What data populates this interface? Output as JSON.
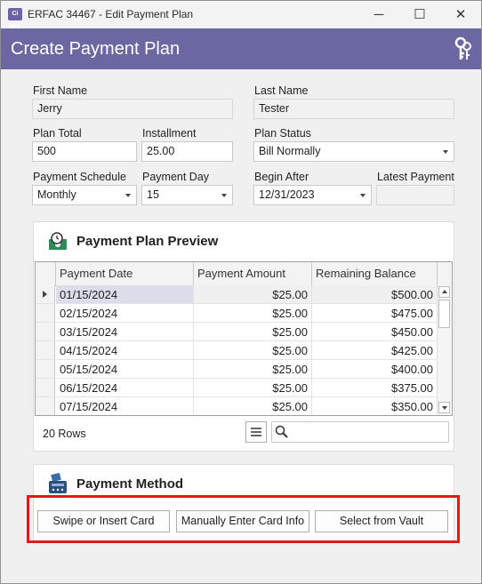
{
  "window": {
    "title": "ERFAC 34467 - Edit Payment Plan",
    "app_icon_text": "Ci pay",
    "minimize": "─",
    "maximize": "☐",
    "close": "✕"
  },
  "header": {
    "title": "Create Payment Plan"
  },
  "form": {
    "first_name_label": "First Name",
    "first_name_value": "Jerry",
    "last_name_label": "Last Name",
    "last_name_value": "Tester",
    "plan_total_label": "Plan Total",
    "plan_total_value": "500",
    "installment_label": "Installment",
    "installment_value": "25.00",
    "plan_status_label": "Plan Status",
    "plan_status_value": "Bill Normally",
    "payment_schedule_label": "Payment Schedule",
    "payment_schedule_value": "Monthly",
    "payment_day_label": "Payment Day",
    "payment_day_value": "15",
    "begin_after_label": "Begin After",
    "begin_after_value": "12/31/2023",
    "latest_payment_label": "Latest Payment",
    "latest_payment_value": ""
  },
  "preview": {
    "title": "Payment Plan Preview",
    "columns": [
      "Payment Date",
      "Payment Amount",
      "Remaining Balance"
    ],
    "rows": [
      [
        "01/15/2024",
        "$25.00",
        "$500.00"
      ],
      [
        "02/15/2024",
        "$25.00",
        "$475.00"
      ],
      [
        "03/15/2024",
        "$25.00",
        "$450.00"
      ],
      [
        "04/15/2024",
        "$25.00",
        "$425.00"
      ],
      [
        "05/15/2024",
        "$25.00",
        "$400.00"
      ],
      [
        "06/15/2024",
        "$25.00",
        "$375.00"
      ],
      [
        "07/15/2024",
        "$25.00",
        "$350.00"
      ]
    ],
    "row_count": "20 Rows",
    "search_value": ""
  },
  "payment_method": {
    "title": "Payment Method",
    "swipe_label": "Swipe or Insert Card",
    "manual_label": "Manually Enter Card Info",
    "vault_label": "Select from Vault"
  },
  "colors": {
    "header": "#6b67a0",
    "highlight": "#e8141b",
    "selected_cell": "#dcdcea"
  }
}
